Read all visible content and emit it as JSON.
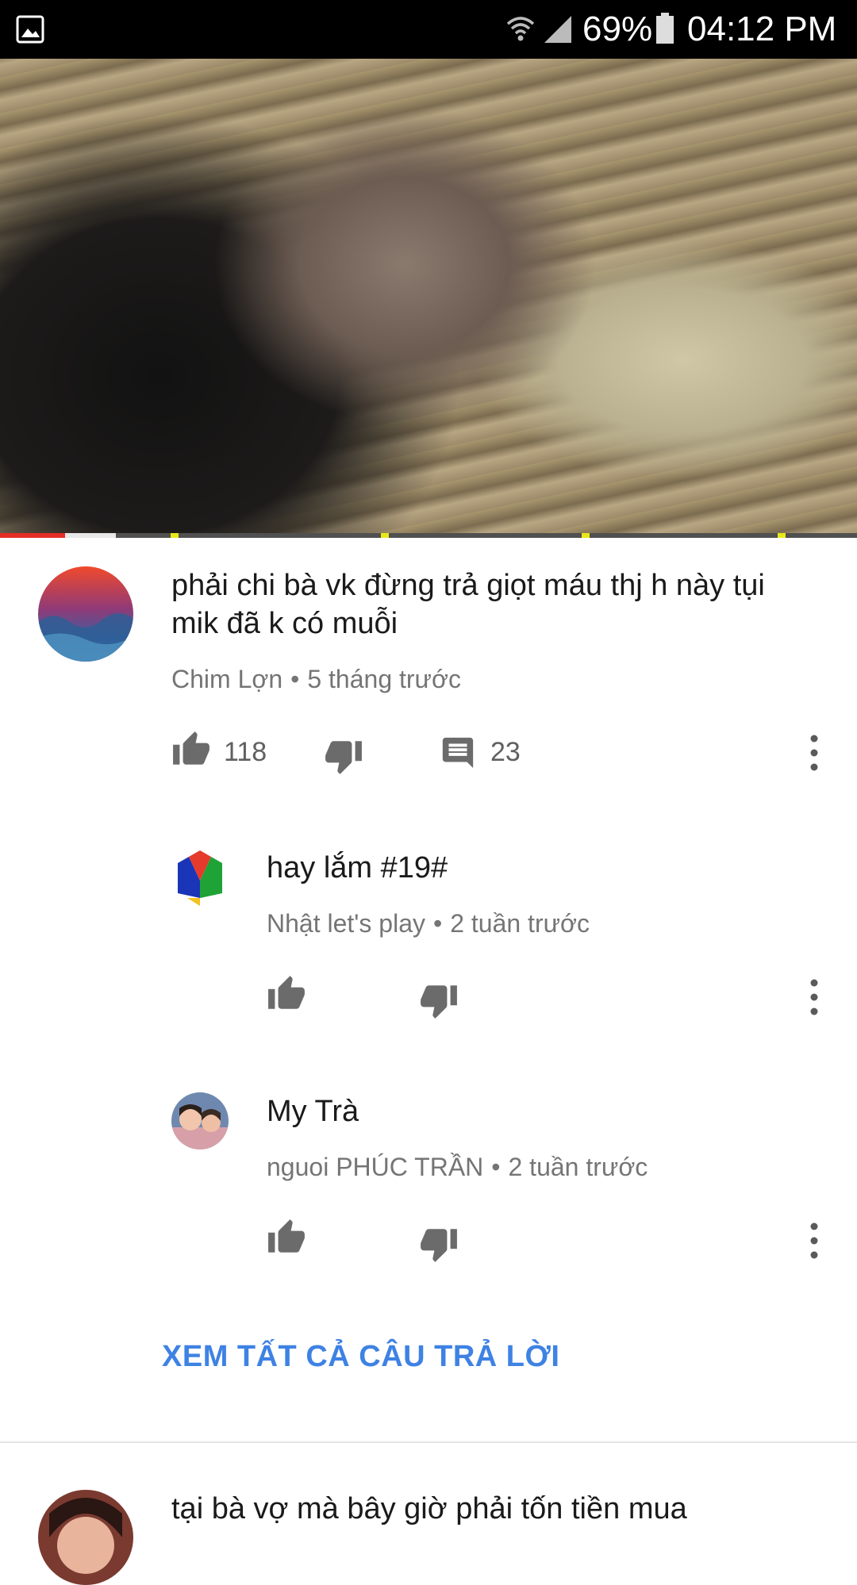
{
  "status_bar": {
    "battery": "69%",
    "time": "04:12 PM",
    "icons": [
      "gallery-icon",
      "wifi-icon",
      "signal-icon",
      "battery-icon"
    ]
  },
  "video": {
    "progress": 0.076,
    "buffered": 0.135
  },
  "comments": {
    "main": {
      "text": "phải chi bà vk đừng trả giọt máu thj h này tụi mik đã k có muỗi",
      "author": "Chim Lợn",
      "time": "5 tháng trước",
      "likes": "118",
      "replies": "23"
    },
    "replies": [
      {
        "text": "hay lắm #19#",
        "author": "Nhật let's play",
        "time": "2 tuần trước"
      },
      {
        "text": "My Trà",
        "author": "nguoi PHÚC TRẦN",
        "time": "2 tuần trước"
      }
    ],
    "see_all": "XEM TẤT CẢ CÂU TRẢ LỜI",
    "next": {
      "text": "tại bà vợ mà bây giờ phải tốn tiền mua"
    }
  },
  "colors": {
    "link": "#3e82e4",
    "progress_played": "#e52d27",
    "marker": "#e8e81a"
  }
}
